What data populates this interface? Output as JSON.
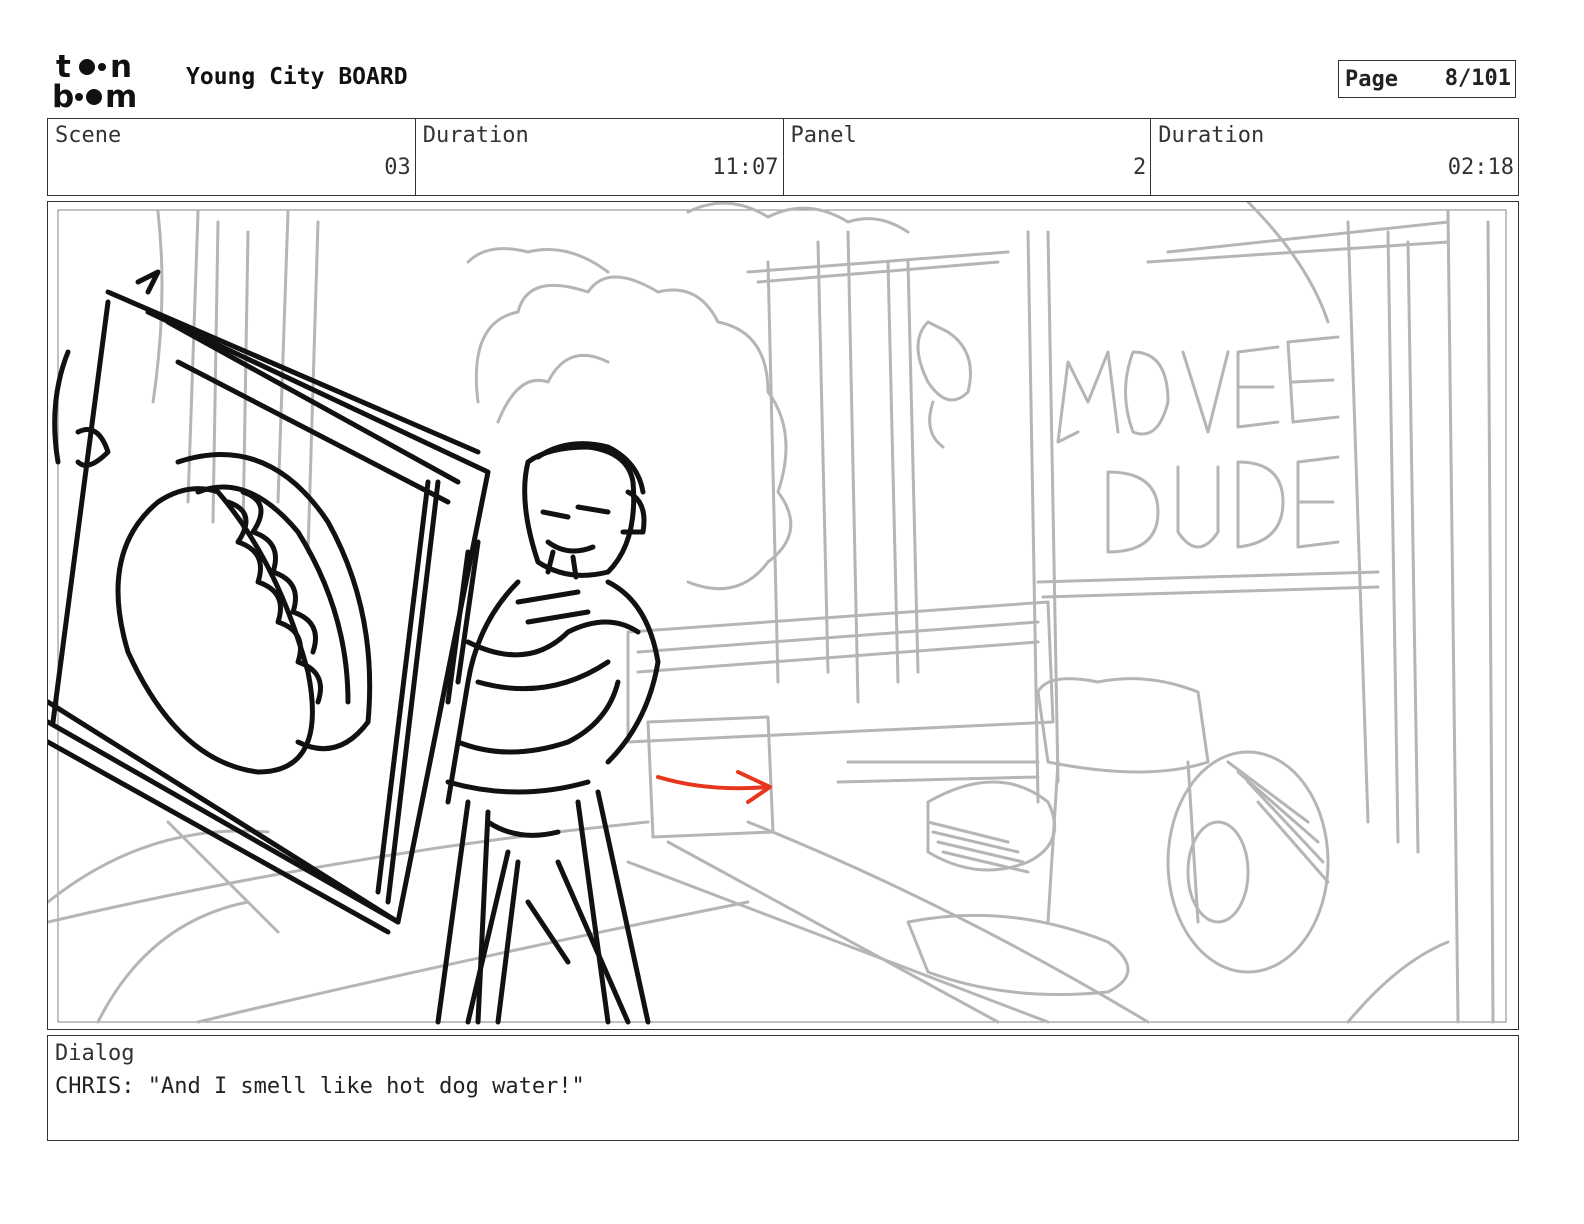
{
  "header": {
    "logo_text": "toon boom",
    "project_title": "Young City BOARD",
    "page_label": "Page",
    "page_value": "8/101"
  },
  "info": {
    "scene_label": "Scene",
    "scene_value": "03",
    "scene_duration_label": "Duration",
    "scene_duration_value": "11:07",
    "panel_label": "Panel",
    "panel_value": "2",
    "panel_duration_label": "Duration",
    "panel_duration_value": "02:18"
  },
  "panel": {
    "sign_text_line1": "MOVE",
    "sign_text_line2": "DUDE",
    "arrow_color": "#e8361c",
    "sketch_rough_color": "#b5b5b5",
    "sketch_ink_color": "#111111"
  },
  "dialog": {
    "label": "Dialog",
    "text": "CHRIS: \"And I smell like hot dog water!\""
  }
}
